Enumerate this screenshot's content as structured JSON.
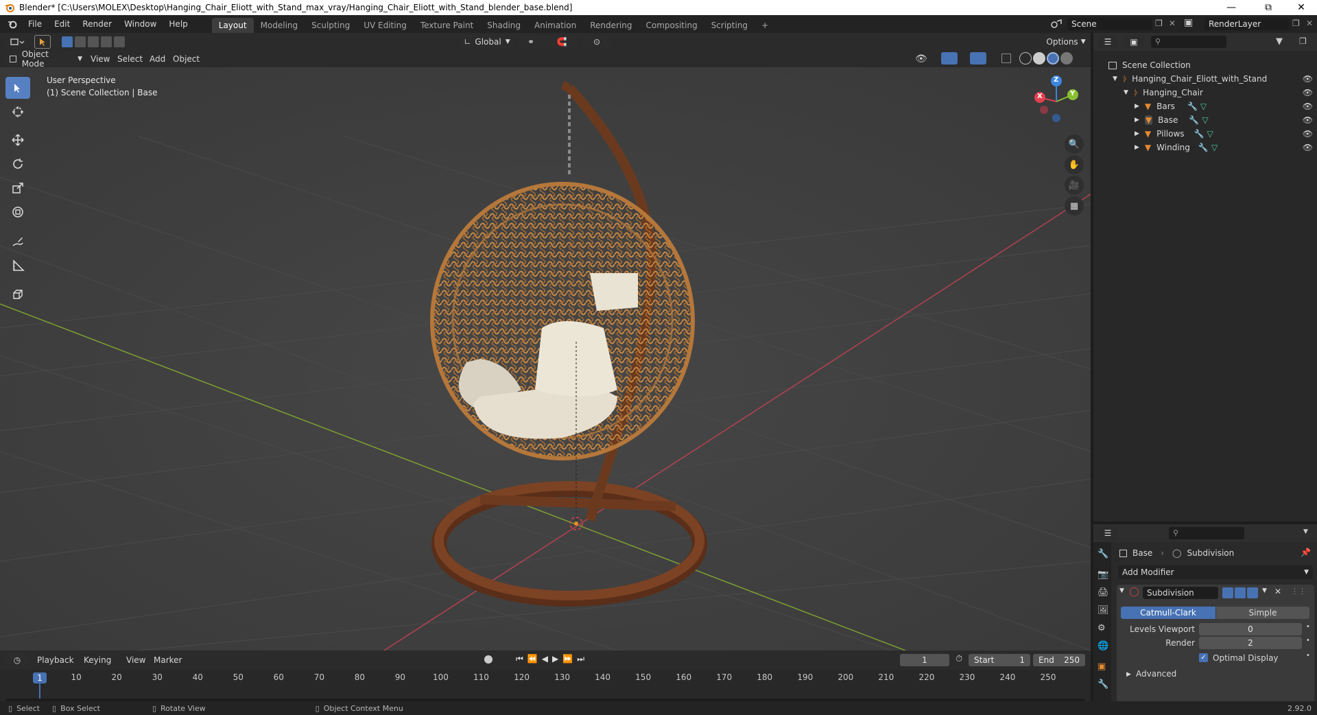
{
  "window": {
    "title": "Blender* [C:\\Users\\MOLEX\\Desktop\\Hanging_Chair_Eliott_with_Stand_max_vray/Hanging_Chair_Eliott_with_Stand_blender_base.blend]"
  },
  "menu": {
    "items": [
      "File",
      "Edit",
      "Render",
      "Window",
      "Help"
    ]
  },
  "workspaces": {
    "tabs": [
      "Layout",
      "Modeling",
      "Sculpting",
      "UV Editing",
      "Texture Paint",
      "Shading",
      "Animation",
      "Rendering",
      "Compositing",
      "Scripting"
    ],
    "active": "Layout",
    "add": "+"
  },
  "scene": {
    "name": "Scene",
    "layer": "RenderLayer"
  },
  "viewport_header": {
    "orientation": "Global",
    "options": "Options",
    "mode": "Object Mode",
    "menus": [
      "View",
      "Select",
      "Add",
      "Object"
    ]
  },
  "viewport": {
    "perspective": "User Perspective",
    "collection": "(1) Scene Collection | Base",
    "gizmo": {
      "x": "X",
      "y": "Y",
      "z": "Z"
    }
  },
  "outliner": {
    "root": "Scene Collection",
    "collection": "Hanging_Chair_Eliott_with_Stand",
    "group": "Hanging_Chair",
    "objects": [
      "Bars",
      "Base",
      "Pillows",
      "Winding"
    ]
  },
  "properties": {
    "object": "Base",
    "modifier_breadcrumb": "Subdivision",
    "add_modifier": "Add Modifier",
    "modifier_name": "Subdivision",
    "algo_options": [
      "Catmull-Clark",
      "Simple"
    ],
    "algo_active": "Catmull-Clark",
    "levels_viewport_label": "Levels Viewport",
    "levels_viewport": "0",
    "render_label": "Render",
    "render": "2",
    "optimal_display": "Optimal Display",
    "advanced": "Advanced"
  },
  "timeline": {
    "menus": [
      "Playback",
      "Keying",
      "View",
      "Marker"
    ],
    "current_frame": "1",
    "start_label": "Start",
    "start": "1",
    "end_label": "End",
    "end": "250",
    "ticks": [
      "1",
      "10",
      "20",
      "30",
      "40",
      "50",
      "60",
      "70",
      "80",
      "90",
      "100",
      "110",
      "120",
      "130",
      "140",
      "150",
      "160",
      "170",
      "180",
      "190",
      "200",
      "210",
      "220",
      "230",
      "240",
      "250"
    ]
  },
  "statusbar": {
    "select": "Select",
    "box_select": "Box Select",
    "rotate": "Rotate View",
    "context": "Object Context Menu",
    "version": "2.92.0"
  },
  "colors": {
    "accent": "#4772b3",
    "viewport_bg": "#3e3e3e",
    "x_axis": "#e04050",
    "y_axis": "#88c030",
    "z_axis": "#3d85e0",
    "object_orange": "#e58a31"
  }
}
